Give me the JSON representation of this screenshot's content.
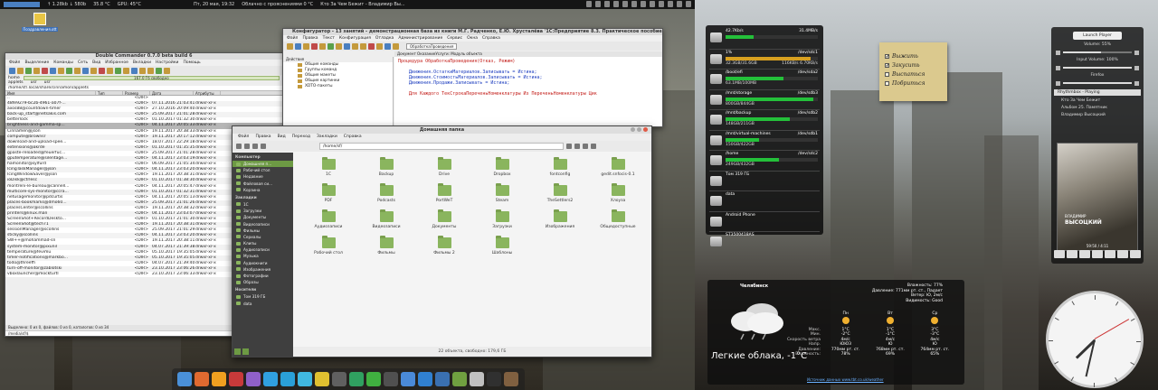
{
  "topbar": {
    "net": "↑ 1.28kb ↓ 580b",
    "cpu_temp": "35.8 °C",
    "gpu": "GPU: 45°C",
    "datetime": "Пт, 20 мая, 19:32",
    "weather": "Облачно с прояснениями 0 °C",
    "now_playing": "Кто За Чем Бежит - Владимир Вы..."
  },
  "desktop_icon": {
    "label": "Поздравления.ott"
  },
  "double_commander": {
    "title": "Double Commander 0.7.0 beta build 6",
    "menu": [
      "Файл",
      "Выделение",
      "Команды",
      "Сеть",
      "Вид",
      "Избранное",
      "Вкладки",
      "Настройки",
      "Помощь"
    ],
    "drive": "home",
    "free": "167.0 Гб свободно",
    "tabs": [
      "applets",
      "usr",
      "usr"
    ],
    "path": "/home/sf/.local/share/cinnamon/applets",
    "columns": [
      "Имя",
      "Тип",
      "Размер",
      "Дата",
      "Атрибуты"
    ],
    "rows": [
      {
        "name": "..",
        "size": "<DIR>",
        "date": "",
        "attr": ""
      },
      {
        "name": "48fe9279-bc2b-4961-a07f-...",
        "size": "<DIR>",
        "date": "07.11.2016 21:03:41",
        "attr": "drwxr-xr-x"
      },
      {
        "name": "axos88@countdown-timer",
        "size": "<DIR>",
        "date": "27.10.2016 20:09:40",
        "attr": "drwxr-xr-x"
      },
      {
        "name": "back-up_start@netsakis.com",
        "size": "<DIR>",
        "date": "25.09.2017 21:01:28",
        "attr": "drwxr-xr-x"
      },
      {
        "name": "betterlock",
        "size": "<DIR>",
        "date": "01.10.2017 01:32:30",
        "attr": "drwxr-xr-x"
      },
      {
        "name": "brightness-and-gamma-sp...",
        "size": "<DIR>",
        "date": "04.11.2017 20:05:33",
        "attr": "drwxr-xr-x"
      },
      {
        "name": "Cinnamen@json",
        "size": "<DIR>",
        "date": "19.11.2017 20:38:33",
        "attr": "drwxr-xr-x"
      },
      {
        "name": "compute@brownsr",
        "size": "<DIR>",
        "date": "19.11.2017 20:17:12",
        "attr": "drwxr-xr-x"
      },
      {
        "name": "download-and-upload-spee...",
        "size": "<DIR>",
        "date": "18.07.2017 22:29:18",
        "attr": "drwxr-xr-x"
      },
      {
        "name": "extensions@akrde",
        "size": "<DIR>",
        "date": "01.10.2017 01:35:35",
        "attr": "drwxr-xr-x"
      },
      {
        "name": "gpaste-reloaded@feuerfuc...",
        "size": "<DIR>",
        "date": "25.09.2017 21:01:28",
        "attr": "drwxr-xr-x"
      },
      {
        "name": "gputemperature@silentage...",
        "size": "<DIR>",
        "date": "04.11.2017 23:03:19",
        "attr": "drwxr-xr-x"
      },
      {
        "name": "hamonitor@sylfurd",
        "size": "<DIR>",
        "date": "06.09.2017 21:05:34",
        "attr": "drwxr-xr-x"
      },
      {
        "name": "IcingTaskManager@json",
        "size": "<DIR>",
        "date": "04.11.2017 23:03:20",
        "attr": "drwxr-xr-x"
      },
      {
        "name": "IcingWindowSaver@json",
        "size": "<DIR>",
        "date": "19.11.2017 20:38:31",
        "attr": "drwxr-xr-x"
      },
      {
        "name": "ioDisk@ctrlesc",
        "size": "<DIR>",
        "date": "01.10.2017 01:38:30",
        "attr": "drwxr-xr-x"
      },
      {
        "name": "montreni-le-bureau@cannell...",
        "size": "<DIR>",
        "date": "04.11.2017 20:05:47",
        "attr": "drwxr-xr-x"
      },
      {
        "name": "multicore-sys-monitor@ccra...",
        "size": "<DIR>",
        "date": "01.10.2017 01:32:31",
        "attr": "drwxr-xr-x"
      },
      {
        "name": "netusagemonitor@pdcurtis",
        "size": "<DIR>",
        "date": "04.11.2017 20:05:13",
        "attr": "drwxr-xr-x"
      },
      {
        "name": "places-bookmarks@dmo60...",
        "size": "<DIR>",
        "date": "25.09.2017 21:01:26",
        "attr": "drwxr-xr-x"
      },
      {
        "name": "placesCenter@scollins",
        "size": "<DIR>",
        "date": "19.11.2017 20:38:32",
        "attr": "drwxr-xr-x"
      },
      {
        "name": "printers@linux.man",
        "size": "<DIR>",
        "date": "04.11.2017 23:03:07",
        "attr": "drwxr-xr-x"
      },
      {
        "name": "ScreenShot+RecordDeskto...",
        "size": "<DIR>",
        "date": "01.10.2017 21:01:30",
        "attr": "drwxr-xr-x"
      },
      {
        "name": "ScreenShot@tech71",
        "size": "<DIR>",
        "date": "19.11.2017 20:38:31",
        "attr": "drwxr-xr-x"
      },
      {
        "name": "sessionManager@scollins",
        "size": "<DIR>",
        "date": "25.09.2017 21:01:29",
        "attr": "drwxr-xr-x"
      },
      {
        "name": "sticky@scollins",
        "size": "<DIR>",
        "date": "04.11.2017 23:03:20",
        "attr": "drwxr-xr-x"
      },
      {
        "name": "SW++@mohammad-sn",
        "size": "<DIR>",
        "date": "19.11.2017 20:38:11",
        "attr": "drwxr-xr-x"
      },
      {
        "name": "system-monitor@pixunil",
        "size": "<DIR>",
        "date": "04.07.2017 21:39:38",
        "attr": "drwxr-xr-x"
      },
      {
        "name": "temperature@fevimu",
        "size": "<DIR>",
        "date": "05.10.2017 19:35:05",
        "attr": "drwxr-xr-x"
      },
      {
        "name": "timer-notifications@markbo...",
        "size": "<DIR>",
        "date": "05.10.2017 19:35:05",
        "attr": "drwxr-xr-x"
      },
      {
        "name": "todo@threeffi",
        "size": "<DIR>",
        "date": "04.07.2017 21:39:40",
        "attr": "drwxr-xr-x"
      },
      {
        "name": "turn-off-monitor@zablotski",
        "size": "<DIR>",
        "date": "23.10.2017 23:06:26",
        "attr": "drwxr-xr-x"
      },
      {
        "name": "vboxlauncher@mockturtl",
        "size": "<DIR>",
        "date": "23.10.2017 23:06:33",
        "attr": "drwxr-xr-x"
      }
    ],
    "status": "Выделено: 0 из 0, файлов: 0 из 0, каталогов: 0 из 34",
    "cmdline": "/media/sf/$"
  },
  "configurator": {
    "title": "Конфигуратор - 13 занятий - демонстрационная база из книги М.Г. Радченко, Е.Ю. Хрусталёва '1С:Предприятие 8.3. Практическое пособие раз...",
    "menu": [
      "Файл",
      "Правка",
      "Текст",
      "Конфигурация",
      "Отладка",
      "Администрирование",
      "Сервис",
      "Окна",
      "Справка"
    ],
    "tab": "ОбработкаПроведения",
    "module_title": "Документ ОказаниеУслуги: Модуль объекта",
    "actions": "Действия",
    "tree": [
      "Общие команды",
      "Группы команд",
      "Общие макеты",
      "Общие картинки",
      "XDTO-пакеты"
    ],
    "code": [
      {
        "t": "Процедура ОбработкаПроведения(Отказ, Режим)",
        "k": "kw"
      },
      {
        "t": "",
        "k": ""
      },
      {
        "t": "    Движения.ОстаткиМатериалов.Записывать = Истина;",
        "k": "bl"
      },
      {
        "t": "    Движения.СтоимостьМатериалов.Записывать = Истина;",
        "k": "bl"
      },
      {
        "t": "    Движения.Продажи.Записывать = Истина;",
        "k": "bl"
      },
      {
        "t": "",
        "k": ""
      },
      {
        "t": "    Для Каждого ТекСтрокаПереченьНоменклатуры Из ПереченьНоменклатуры Цик",
        "k": "kw"
      }
    ],
    "bottom_tabs": [
      "Конфигурат...",
      "Документ...",
      "Документ...",
      "Обработк..."
    ]
  },
  "nemo": {
    "title": "Домашняя папка",
    "menu": [
      "Файл",
      "Правка",
      "Вид",
      "Переход",
      "Закладки",
      "Справка"
    ],
    "path": "/home/sf/",
    "sections": {
      "computer": "Компьютер",
      "bookmarks": "Закладки",
      "network": "Носители"
    },
    "computer_items": [
      "Домашняя п...",
      "Рабочий стол",
      "Недавние",
      "Файловая си...",
      "Корзина"
    ],
    "bookmarks": [
      "1С",
      "Загрузки",
      "Документы",
      "Видеозаписи",
      "Фильмы",
      "Сериалы",
      "Клипы",
      "Аудиозаписи",
      "Музыка",
      "Аудиокниги",
      "Изображения",
      "Фотографии",
      "Образы"
    ],
    "network_items": [
      "Том 319 ГБ",
      "data"
    ],
    "folders": [
      "1С",
      "Backup",
      "Drive",
      "Dropbox",
      "fontconfig",
      "gedit.snfocis-0.1",
      "PDF",
      "Podcasts",
      "PortWeT",
      "Steam",
      "TheSettlers2",
      "Хлоуза",
      "Аудиозаписи",
      "Видеозаписи",
      "Документы",
      "Загрузки",
      "Изображения",
      "Общедоступные",
      "Рабочий стол",
      "Фильмы",
      "Фильмы 2",
      "Шаблоны"
    ],
    "status": "22 объекта, свободно: 179,6 ГБ"
  },
  "disks": [
    {
      "left": "42.7Kb/s",
      "right": "31.4MB/s",
      "sub_l": "",
      "sub_r": "",
      "size": "",
      "used": 0.3,
      "kind": "net"
    },
    {
      "left": "1%",
      "right": "/dev/sdc1",
      "size": "32.3GB/31.6GB",
      "used_label": "",
      "used": 0.92
    },
    {
      "left": "/boot/efi",
      "right": "/dev/sda2",
      "size": "63.1MB/100MB",
      "used": 0.63
    },
    {
      "left": "/mnt/storage",
      "right": "/dev/sdb3",
      "size": "800GB/844GB",
      "used": 0.95
    },
    {
      "left": "/mnt/backup",
      "right": "/dev/sdb2",
      "size": "148GB/211GB",
      "used": 0.7
    },
    {
      "left": "/mnt/virtual-machines",
      "right": "/dev/sdb1",
      "size": "150GB/422GB",
      "used": 0.36
    },
    {
      "left": "/home",
      "right": "/dev/sdc2",
      "size": "249GB/432GB",
      "used": 0.58
    },
    {
      "left": "Том 319 ГБ",
      "right": "",
      "size": "",
      "used": 0
    },
    {
      "left": "data",
      "right": "",
      "size": "",
      "used": 0
    },
    {
      "left": "Android Phone",
      "right": "",
      "size": "",
      "used": 0
    },
    {
      "left": "ST3500418AS",
      "right": "",
      "size": "",
      "used": 0
    }
  ],
  "disk_speeds": {
    "read": "116KB/s",
    "write": "6.70KB/s"
  },
  "todo": [
    {
      "text": "Выжить",
      "checked": true
    },
    {
      "text": "Закусить",
      "checked": true
    },
    {
      "text": "Выспаться",
      "checked": false
    },
    {
      "text": "Побриться",
      "checked": false
    }
  ],
  "player": {
    "launch": "Launch Player",
    "volume": "Volume: 55%",
    "volume_level": 0.55,
    "input_volume": "Input Volume: 100%",
    "input_level": 1.0,
    "firefox": "Firefox",
    "playing": "Rhythmbox - Playing",
    "song": "Кто За Чем Бежит",
    "album": "Альбом 25. Памятник",
    "artist": "Владимир Высоцкий",
    "cover_artist": "ВЛАДИМИР",
    "cover_name": "ВЫСОЦКИЙ",
    "time": "59:50 / 4:11"
  },
  "weather": {
    "city": "Челябинск",
    "condition": "Легкие облака, -1°C",
    "humidity": "Влажность: 77%",
    "pressure": "Давление: 771мм рт. ст., Падает",
    "wind": "Ветер: Ю, 2м/с",
    "visibility": "Видимость: Good",
    "days": [
      "Пн",
      "Вт",
      "Ср"
    ],
    "rows": [
      {
        "label": "Макс.",
        "vals": [
          "1°C",
          "1°C",
          "3°C"
        ]
      },
      {
        "label": "Мин.",
        "vals": [
          "-2°C",
          "-1°C",
          "-3°C"
        ]
      },
      {
        "label": "Скорость ветра",
        "vals": [
          "4м/с",
          "4м/с",
          "4м/с"
        ]
      },
      {
        "label": "Напр.",
        "vals": [
          "ЮЮЗ",
          "Ю",
          "Ю"
        ]
      },
      {
        "label": "Давление:",
        "vals": [
          "770мм рт. ст.",
          "768мм рт. ст.",
          "764мм рт. ст."
        ]
      },
      {
        "label": "Влажность:",
        "vals": [
          "78%",
          "69%",
          "65%"
        ]
      }
    ],
    "source": "Источник данных www.tbt.co.uk/weather"
  },
  "clock": {
    "hour": 19,
    "minute": 32,
    "second": 10
  }
}
